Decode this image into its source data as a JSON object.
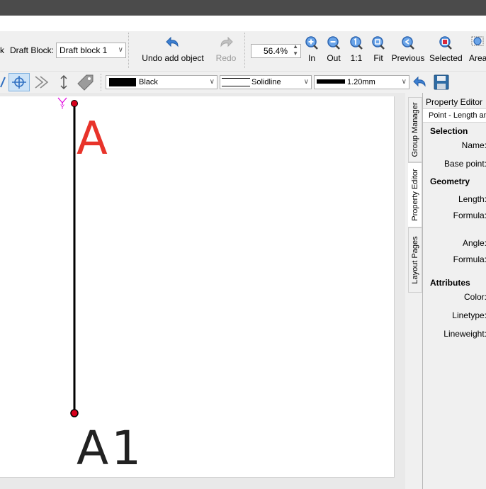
{
  "toolbar1": {
    "left_cut_label": "k",
    "draft_block_label": "Draft Block:",
    "draft_block_value": "Draft block 1",
    "undo_label": "Undo add object",
    "redo_label": "Redo",
    "zoom_value": "56.4%",
    "zoom_buttons": [
      {
        "label": "In"
      },
      {
        "label": "Out"
      },
      {
        "label": "1:1"
      },
      {
        "label": "Fit"
      },
      {
        "label": "Previous"
      },
      {
        "label": "Selected"
      },
      {
        "label": "Area"
      }
    ]
  },
  "toolbar2": {
    "color_value": "Black",
    "linetype_value": "Solidline",
    "lineweight_value": "1.20mm"
  },
  "canvas": {
    "point_a_label": "A",
    "point_a1_label": "A1",
    "axis_label": "Y"
  },
  "side_tabs": [
    "Group Manager",
    "Property Editor",
    "Layout Pages"
  ],
  "property_editor": {
    "title": "Property Editor",
    "subtitle": "Point - Length and",
    "sections": {
      "selection": "Selection",
      "geometry": "Geometry",
      "attributes": "Attributes"
    },
    "labels": {
      "name": "Name:",
      "base_point": "Base point:",
      "length": "Length:",
      "length_formula": "Formula:",
      "angle": "Angle:",
      "angle_formula": "Formula:",
      "color": "Color:",
      "linetype": "Linetype:",
      "lineweight": "Lineweight:"
    }
  },
  "colors": {
    "accent_blue": "#2f6fc1",
    "label_red": "#e8332a",
    "point_red": "#d8001c",
    "axis_magenta": "#e000e0"
  }
}
